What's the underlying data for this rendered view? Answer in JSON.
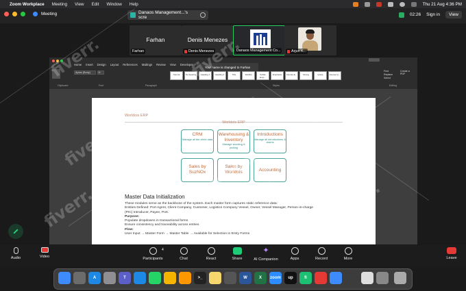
{
  "menubar": {
    "app_name": "Zoom Workplace",
    "items": [
      "Meeting",
      "View",
      "Edit",
      "Window",
      "Help"
    ],
    "datetime": "Thu 21 Aug  4:36 PM"
  },
  "zoom_top": {
    "meeting_label": "Meeting",
    "share_title": "Danaos Management...'s scre",
    "timer": "02:26",
    "signin": "Sign in",
    "view": "View"
  },
  "participants": [
    {
      "big": "Farhan",
      "label": "Farhan"
    },
    {
      "big": "Denis Menezes",
      "label": "Denis Menezes"
    },
    {
      "big": "",
      "label": "Danaos Management Co..."
    },
    {
      "big": "",
      "label": "Arjun K..."
    }
  ],
  "word": {
    "tabs": [
      "Home",
      "Insert",
      "Design",
      "Layout",
      "References",
      "Mailings",
      "Review",
      "View",
      "Developer",
      "Help",
      "Acrobat"
    ],
    "font": "Aptos (Body)",
    "size": "11",
    "styles": [
      "Normal",
      "No Spacing",
      "Heading 1",
      "Heading 2",
      "Title",
      "Subtitle",
      "Subtle Emp...",
      "Emphasis",
      "Intense E...",
      "Strong",
      "Quote",
      "Intense Q..."
    ],
    "groups": {
      "clipboard": "Clipboard",
      "font": "Font",
      "paragraph": "Paragraph",
      "styles": "Styles",
      "editing": "Editing"
    },
    "right_tools": [
      "Find",
      "Replace",
      "Select",
      "Create a PDF"
    ]
  },
  "tooltip": "Your name is changed to Farhan",
  "document": {
    "header": "Worldois ERP",
    "center_title": "Worldols ERP",
    "modules": [
      {
        "title": "CRM",
        "sub": "Manage all the client data"
      },
      {
        "title": "Warehousing & Inventory",
        "sub": "Manage stocking & picking"
      },
      {
        "title": "Introductions",
        "sub": "Manage all introductions & claims"
      },
      {
        "title": "Sales by SuzNOx",
        "sub": ""
      },
      {
        "title": "Sales by Worldols",
        "sub": ""
      },
      {
        "title": "Accounting",
        "sub": ""
      }
    ],
    "heading": "Master Data Initialization",
    "lines": [
      "These modules serve as the backbone of the system. Each master form captures static reference data:",
      "Entities Defined: Port Agent, Client Company, Customer, Logistics Company Vessel, Owner, Vessel Manager, Person-in-charge",
      "(PIC) Introducer, Payee, Port.",
      "Purpose:",
      "Populate dropdowns in transactional forms",
      "Ensure consistency and traceability across entries",
      "Flow:",
      "User Input → Master Form → Master Table → Available for Selection in Entry Forms"
    ]
  },
  "controls": [
    "Audio",
    "Video",
    "Participants",
    "Chat",
    "React",
    "Share",
    "AI Companion",
    "Apps",
    "Record",
    "More",
    "Leave"
  ],
  "participants_count": "4",
  "watermark": "fiverr.",
  "dock": [
    "Finder",
    "Launchpad",
    "App Store",
    "System Settings",
    "Teams",
    "Safari",
    "WhatsApp",
    "Chrome",
    "Sublime Text",
    "Terminal",
    "Notes",
    "Calculator",
    "Word",
    "Excel",
    "Zoom",
    "Upwork",
    "Fiverr",
    "Yogesh",
    "Mail",
    "Preview",
    "Downloads",
    "Trash"
  ],
  "colors": {
    "accent_green": "#23d160",
    "teal_border": "#4aa39a",
    "orange_text": "#bf6a3a",
    "leave_red": "#e53935"
  }
}
